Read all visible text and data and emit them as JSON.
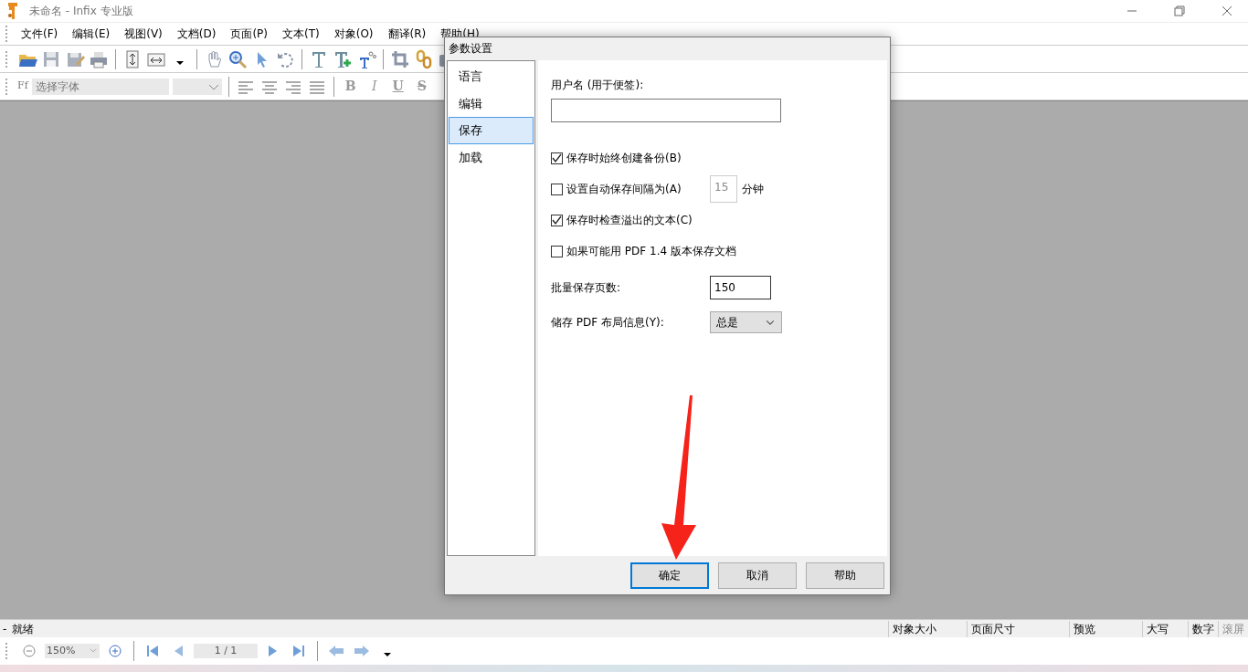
{
  "window": {
    "title": "未命名 - Infix 专业版"
  },
  "menu": [
    "文件(F)",
    "编辑(E)",
    "视图(V)",
    "文档(D)",
    "页面(P)",
    "文本(T)",
    "对象(O)",
    "翻译(R)",
    "帮助(H)"
  ],
  "format_bar": {
    "font_icon": "Ff",
    "font_field": {
      "placeholder": "选择字体"
    },
    "style_buttons": [
      "B",
      "I",
      "U",
      "S"
    ]
  },
  "dialog": {
    "title": "参数设置",
    "categories": [
      {
        "label": "语言",
        "selected": false
      },
      {
        "label": "编辑",
        "selected": false
      },
      {
        "label": "保存",
        "selected": true
      },
      {
        "label": "加载",
        "selected": false
      }
    ],
    "username_label": "用户名 (用于便签):",
    "options": [
      {
        "kind": "checkbox",
        "label": "保存时始终创建备份(B)",
        "checked": true
      },
      {
        "kind": "interval",
        "label": "设置自动保存间隔为(A)",
        "checked": false,
        "value": "15",
        "unit": "分钟"
      },
      {
        "kind": "checkbox",
        "label": "保存时检查溢出的文本(C)",
        "checked": true
      },
      {
        "kind": "checkbox",
        "label": "如果可能用 PDF 1.4 版本保存文档",
        "checked": false
      },
      {
        "kind": "input",
        "label": "批量保存页数:",
        "value": "150"
      },
      {
        "kind": "select",
        "label": "储存 PDF 布局信息(Y):",
        "value": "总是"
      }
    ],
    "buttons": [
      {
        "label": "确定",
        "default": true
      },
      {
        "label": "取消",
        "default": false
      },
      {
        "label": "帮助",
        "default": false
      }
    ]
  },
  "status_bar": {
    "marker": "-",
    "message": "就绪",
    "panes": [
      {
        "text": "对象大小",
        "disabled": false
      },
      {
        "text": "页面尺寸",
        "disabled": false
      },
      {
        "text": "预览",
        "disabled": false
      },
      {
        "text": "大写",
        "disabled": false
      },
      {
        "text": "数字",
        "disabled": false
      },
      {
        "text": "滚屏",
        "disabled": true
      }
    ]
  },
  "nav_bar": {
    "zoom": "150%",
    "page": "1 / 1"
  }
}
